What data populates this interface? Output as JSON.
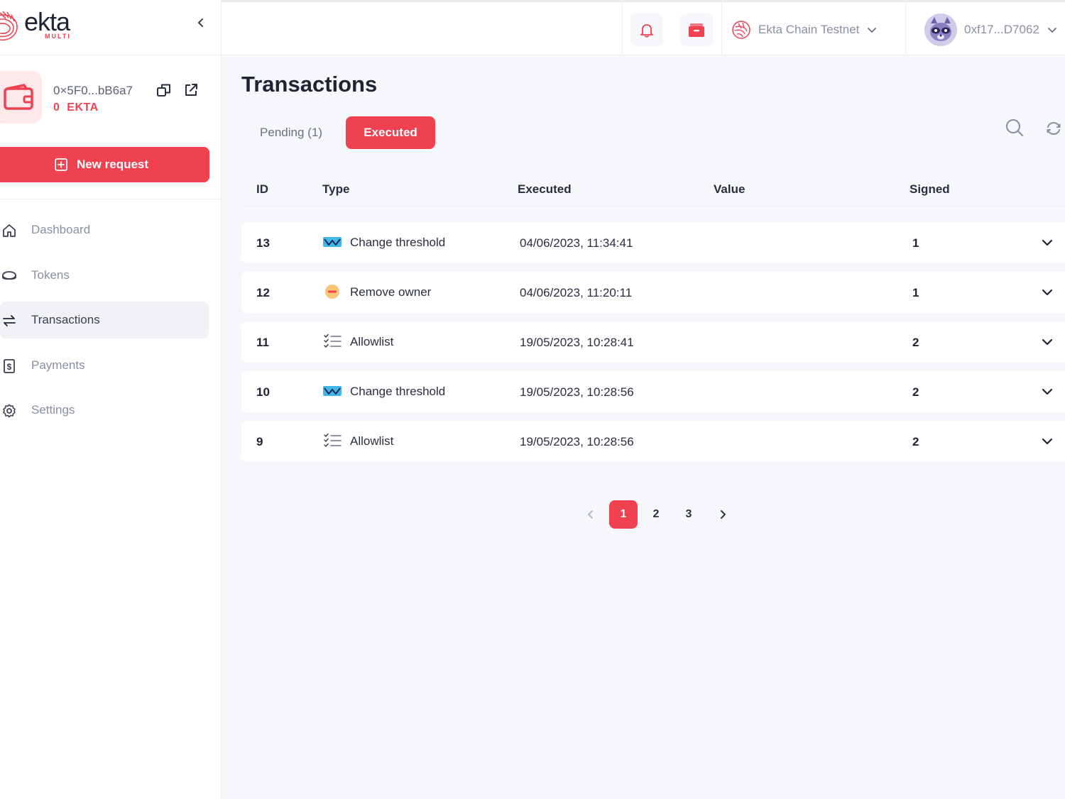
{
  "brand": {
    "name": "ekta",
    "sub": "MULTI"
  },
  "wallet": {
    "address": "0×5F0...bB6a7",
    "balance_amount": "0",
    "balance_symbol": "EKTA"
  },
  "sidebar": {
    "new_request_label": "New request",
    "items": [
      {
        "label": "Dashboard",
        "icon": "home-icon"
      },
      {
        "label": "Tokens",
        "icon": "coin-icon"
      },
      {
        "label": "Transactions",
        "icon": "arrows-exchange-icon",
        "active": true
      },
      {
        "label": "Payments",
        "icon": "dollar-doc-icon"
      },
      {
        "label": "Settings",
        "icon": "gear-icon"
      }
    ]
  },
  "header": {
    "network": "Ekta Chain Testnet",
    "account": "0xf17...D7062"
  },
  "main": {
    "title": "Transactions",
    "tabs": [
      {
        "label": "Pending (1)",
        "active": false
      },
      {
        "label": "Executed",
        "active": true
      }
    ],
    "columns": [
      "ID",
      "Type",
      "Executed",
      "Value",
      "Signed"
    ],
    "rows": [
      {
        "id": "13",
        "type": "Change threshold",
        "icon": "threshold-icon",
        "executed": "04/06/2023, 11:34:41",
        "value": "",
        "signed": "1"
      },
      {
        "id": "12",
        "type": "Remove owner",
        "icon": "remove-owner-icon",
        "executed": "04/06/2023, 11:20:11",
        "value": "",
        "signed": "1"
      },
      {
        "id": "11",
        "type": "Allowlist",
        "icon": "checklist-icon",
        "executed": "19/05/2023, 10:28:41",
        "value": "",
        "signed": "2"
      },
      {
        "id": "10",
        "type": "Change threshold",
        "icon": "threshold-icon",
        "executed": "19/05/2023, 10:28:56",
        "value": "",
        "signed": "2"
      },
      {
        "id": "9",
        "type": "Allowlist",
        "icon": "checklist-icon",
        "executed": "19/05/2023, 10:28:56",
        "value": "",
        "signed": "2"
      }
    ],
    "pagination": {
      "pages": [
        "1",
        "2",
        "3"
      ],
      "current": "1"
    }
  },
  "colors": {
    "accent": "#ef4150",
    "accent_soft": "#fde8ea",
    "muted_text": "#8a8fa3",
    "background": "#f6f7fa"
  }
}
